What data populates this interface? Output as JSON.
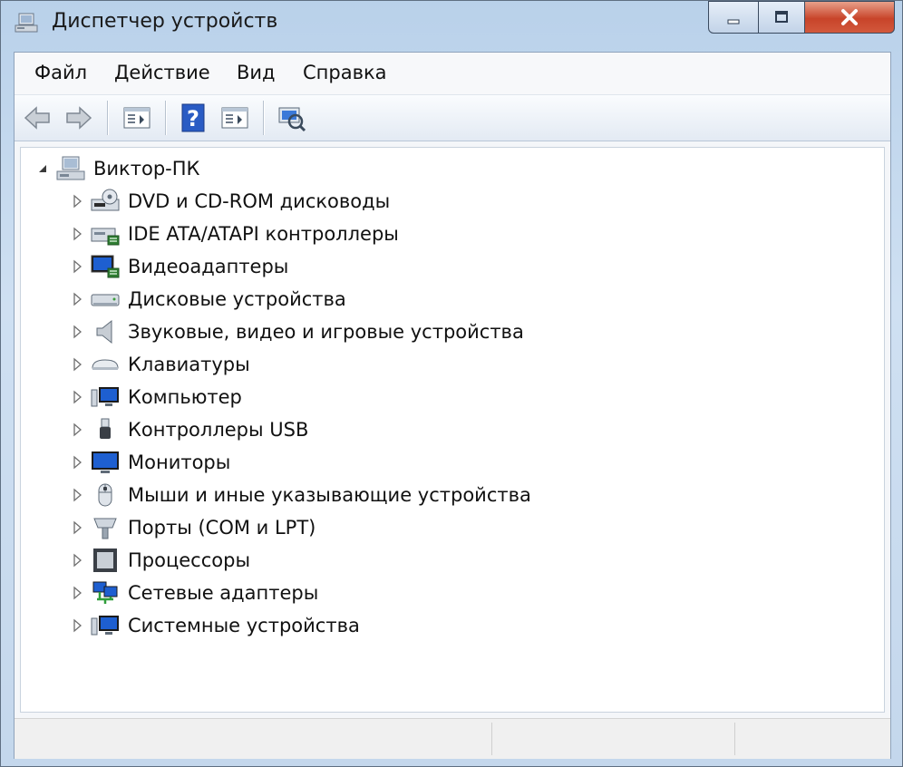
{
  "window": {
    "title": "Диспетчер устройств"
  },
  "menubar": {
    "items": [
      "Файл",
      "Действие",
      "Вид",
      "Справка"
    ]
  },
  "toolbar": {
    "buttons": [
      "back-icon",
      "forward-icon",
      "properties-icon",
      "help-icon",
      "update-driver-icon",
      "scan-hardware-icon"
    ]
  },
  "tree": {
    "root": {
      "label": "Виктор-ПК",
      "icon": "computer-root-icon",
      "expanded": true
    },
    "items": [
      {
        "label": "DVD и CD-ROM дисководы",
        "icon": "dvd-drive-icon"
      },
      {
        "label": "IDE ATA/ATAPI контроллеры",
        "icon": "ide-controller-icon"
      },
      {
        "label": "Видеоадаптеры",
        "icon": "display-adapter-icon"
      },
      {
        "label": "Дисковые устройства",
        "icon": "disk-drive-icon"
      },
      {
        "label": "Звуковые, видео и игровые устройства",
        "icon": "speaker-icon"
      },
      {
        "label": "Клавиатуры",
        "icon": "keyboard-icon"
      },
      {
        "label": "Компьютер",
        "icon": "computer-icon"
      },
      {
        "label": "Контроллеры USB",
        "icon": "usb-icon"
      },
      {
        "label": "Мониторы",
        "icon": "monitor-icon"
      },
      {
        "label": "Мыши и иные указывающие устройства",
        "icon": "mouse-icon"
      },
      {
        "label": "Порты (COM и LPT)",
        "icon": "port-icon"
      },
      {
        "label": "Процессоры",
        "icon": "processor-icon"
      },
      {
        "label": "Сетевые адаптеры",
        "icon": "network-adapter-icon"
      },
      {
        "label": "Системные устройства",
        "icon": "system-devices-icon"
      }
    ]
  },
  "colors": {
    "close_button": "#c8442a",
    "title_bar": "#b9d1ea",
    "monitor_blue": "#1e5fd0"
  }
}
